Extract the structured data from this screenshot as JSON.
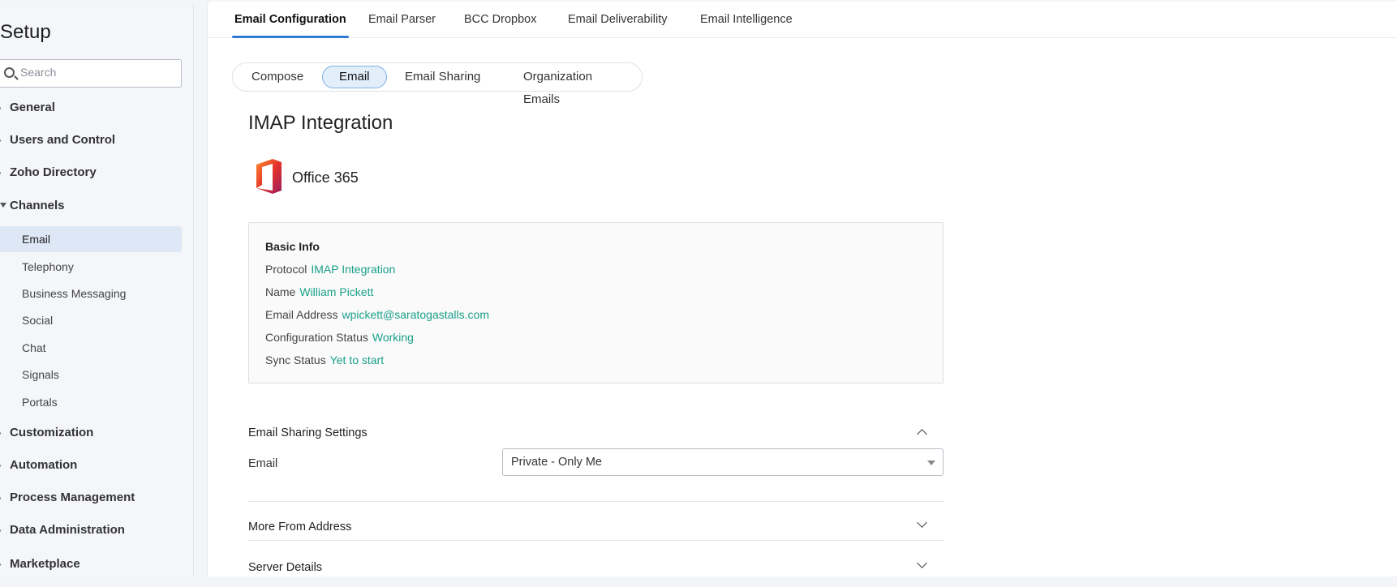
{
  "sidebar": {
    "title": "Setup",
    "search_placeholder": "Search",
    "items": [
      {
        "label": "General"
      },
      {
        "label": "Users and Control"
      },
      {
        "label": "Zoho Directory"
      },
      {
        "label": "Channels"
      }
    ],
    "channels_sub": [
      {
        "label": "Email"
      },
      {
        "label": "Telephony"
      },
      {
        "label": "Business Messaging"
      },
      {
        "label": "Social"
      },
      {
        "label": "Chat"
      },
      {
        "label": "Signals"
      },
      {
        "label": "Portals"
      }
    ],
    "items_after": [
      {
        "label": "Customization"
      },
      {
        "label": "Automation"
      },
      {
        "label": "Process Management"
      },
      {
        "label": "Data Administration"
      },
      {
        "label": "Marketplace"
      }
    ]
  },
  "top_tabs": [
    {
      "label": "Email Configuration"
    },
    {
      "label": "Email Parser"
    },
    {
      "label": "BCC Dropbox"
    },
    {
      "label": "Email Deliverability"
    },
    {
      "label": "Email Intelligence"
    }
  ],
  "sub_tabs": [
    {
      "label": "Compose"
    },
    {
      "label": "Email"
    },
    {
      "label": "Email Sharing"
    },
    {
      "label": "Organization Emails"
    }
  ],
  "page_title": "IMAP Integration",
  "provider": {
    "name": "Office 365",
    "icon": "office365-logo-icon"
  },
  "basic_info": {
    "title": "Basic Info",
    "rows": [
      {
        "label": "Protocol",
        "value": "IMAP Integration"
      },
      {
        "label": "Name",
        "value": "William Pickett"
      },
      {
        "label": "Email Address",
        "value": "wpickett@saratogastalls.com"
      },
      {
        "label": "Configuration Status",
        "value": "Working"
      },
      {
        "label": "Sync Status",
        "value": "Yet to start"
      }
    ]
  },
  "sharing": {
    "title": "Email Sharing Settings",
    "field_label": "Email",
    "selected": "Private - Only Me"
  },
  "sections": [
    {
      "title": "More From Address"
    },
    {
      "title": "Server Details"
    }
  ],
  "colors": {
    "accent": "#2f7bd4",
    "value_text": "#1aa08a",
    "active_nav": "#dde7f5"
  }
}
